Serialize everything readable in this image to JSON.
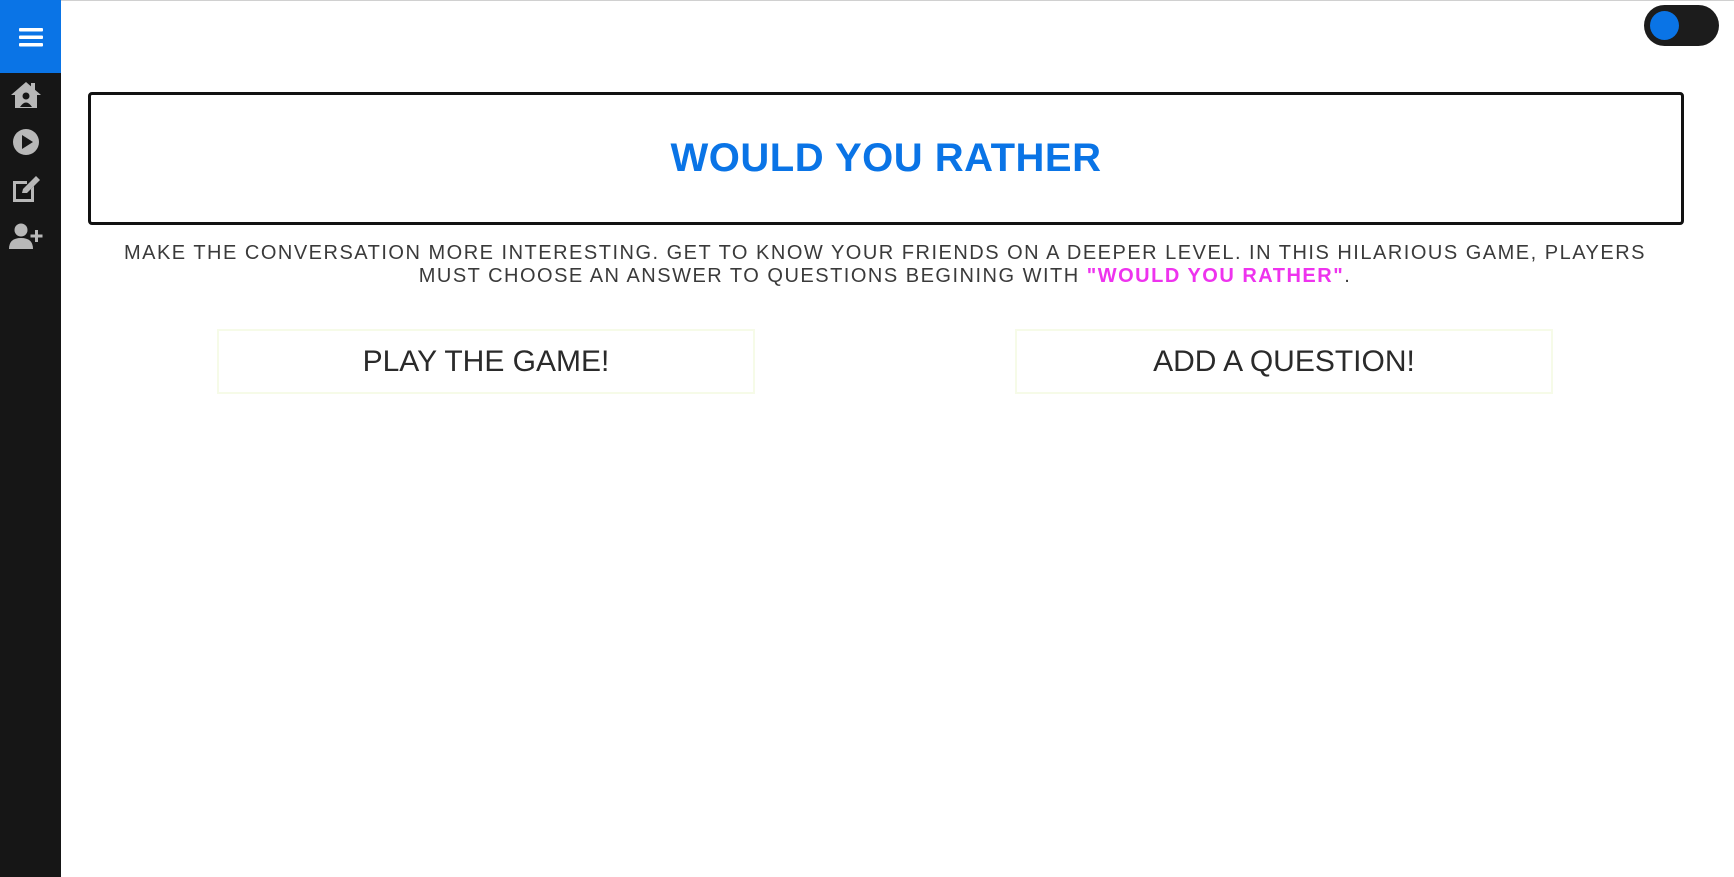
{
  "sidebar": {
    "menu_icon": "hamburger-menu-icon",
    "items": [
      {
        "icon": "home-icon"
      },
      {
        "icon": "play-circle-icon"
      },
      {
        "icon": "edit-icon"
      },
      {
        "icon": "user-plus-icon"
      }
    ]
  },
  "theme_toggle": {
    "state": "on"
  },
  "header": {
    "title": "WOULD YOU RATHER"
  },
  "intro": {
    "text_before": "MAKE THE CONVERSATION MORE INTERESTING. GET TO KNOW YOUR FRIENDS ON A DEEPER LEVEL. IN THIS HILARIOUS GAME, PLAYERS MUST CHOOSE AN ANSWER TO QUESTIONS BEGINING WITH ",
    "highlight": "\"WOULD YOU RATHER\"",
    "text_after": "."
  },
  "actions": {
    "play_label": "PLAY THE GAME!",
    "add_label": "ADD A QUESTION!"
  },
  "colors": {
    "accent": "#0a74e6",
    "highlight": "#ee33ee",
    "sidebar_bg": "#161616"
  }
}
